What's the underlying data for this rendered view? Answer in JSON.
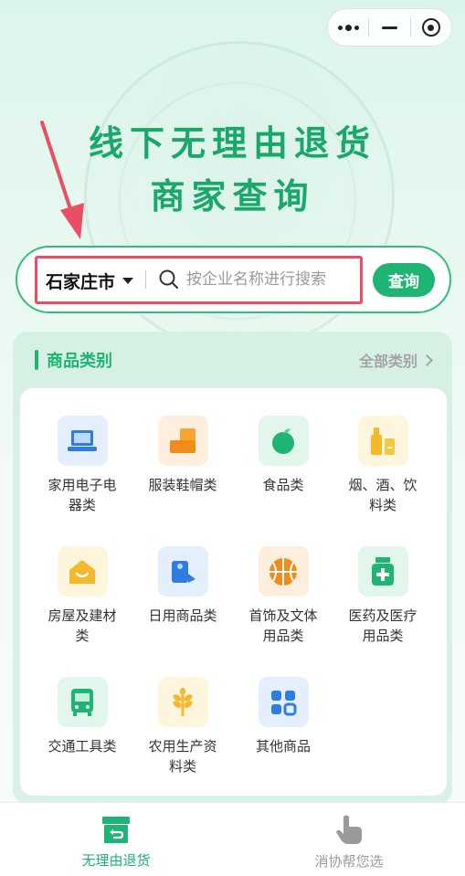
{
  "hero": {
    "title_line1": "线下无理由退货",
    "title_line2": "商家查询"
  },
  "search": {
    "city": "石家庄市",
    "placeholder": "按企业名称进行搜索",
    "button_label": "查询"
  },
  "categories": {
    "title": "商品类别",
    "all_label": "全部类别",
    "items": [
      {
        "label": "家用电子电器类",
        "icon": "laptop-icon"
      },
      {
        "label": "服装鞋帽类",
        "icon": "boot-icon"
      },
      {
        "label": "食品类",
        "icon": "apple-icon"
      },
      {
        "label": "烟、酒、饮料类",
        "icon": "bottle-icon"
      },
      {
        "label": "房屋及建材类",
        "icon": "house-icon"
      },
      {
        "label": "日用商品类",
        "icon": "tissue-roll-icon"
      },
      {
        "label": "首饰及文体用品类",
        "icon": "basketball-icon"
      },
      {
        "label": "医药及医疗用品类",
        "icon": "medicine-icon"
      },
      {
        "label": "交通工具类",
        "icon": "bus-icon"
      },
      {
        "label": "农用生产资料类",
        "icon": "wheat-icon"
      },
      {
        "label": "其他商品",
        "icon": "apps-icon"
      }
    ]
  },
  "tabbar": {
    "tabs": [
      {
        "label": "无理由退货",
        "icon": "return-box-icon",
        "active": true
      },
      {
        "label": "消协帮您选",
        "icon": "hand-pointer-icon",
        "active": false
      }
    ]
  },
  "colors": {
    "accent": "#1eb574",
    "highlight": "#e84f62"
  }
}
